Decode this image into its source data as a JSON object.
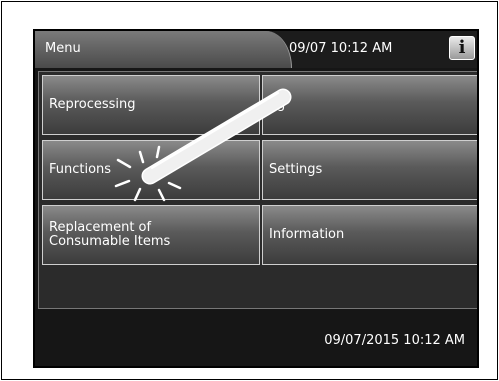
{
  "header": {
    "title": "Menu",
    "datetime": "09/07 10:12 AM",
    "info_label": "i"
  },
  "buttons": {
    "reprocessing": "Reprocessing",
    "log": "og",
    "functions": "Functions",
    "settings": "Settings",
    "replacement": "Replacement of\nConsumable Items",
    "information": "Information"
  },
  "footer": {
    "datetime": "09/07/2015 10:12 AM"
  }
}
